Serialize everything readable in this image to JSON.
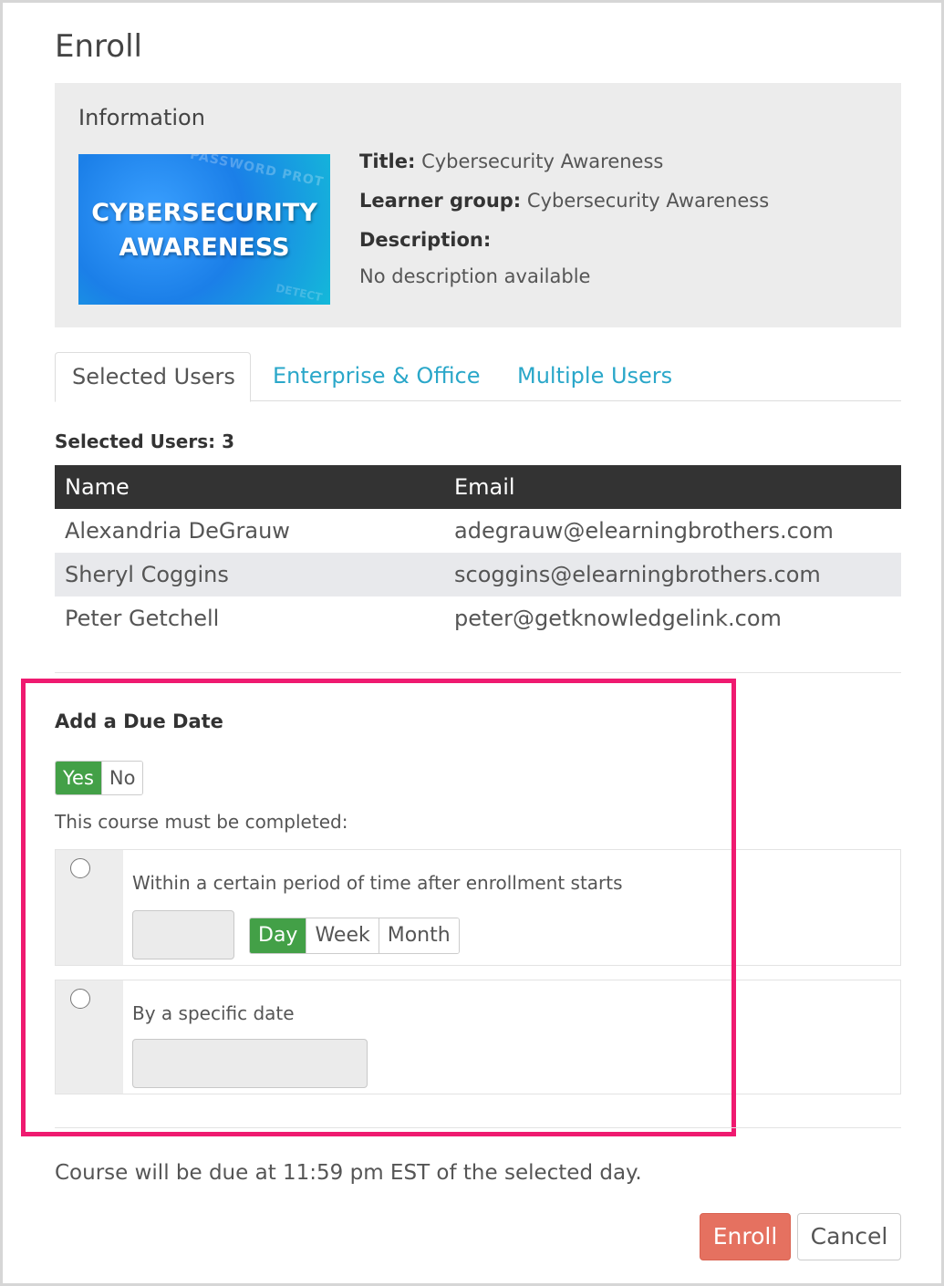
{
  "dialog": {
    "title": "Enroll"
  },
  "information": {
    "heading": "Information",
    "thumbnail": {
      "line1": "CYBERSECURITY",
      "line2": "AWARENESS",
      "deco_top": "PASSWORD PROT",
      "deco_bottom": "DETECT"
    },
    "title_label": "Title:",
    "title_value": "Cybersecurity Awareness",
    "group_label": "Learner group:",
    "group_value": "Cybersecurity Awareness",
    "description_label": "Description:",
    "description_value": "No description available"
  },
  "tabs": [
    {
      "label": "Selected Users",
      "active": true
    },
    {
      "label": "Enterprise & Office",
      "active": false
    },
    {
      "label": "Multiple Users",
      "active": false
    }
  ],
  "selected_count": "Selected Users: 3",
  "table": {
    "headers": [
      "Name",
      "Email"
    ],
    "rows": [
      {
        "name": "Alexandria DeGrauw",
        "email": "adegrauw@elearningbrothers.com"
      },
      {
        "name": "Sheryl Coggins",
        "email": "scoggins@elearningbrothers.com"
      },
      {
        "name": "Peter Getchell",
        "email": "peter@getknowledgelink.com"
      }
    ]
  },
  "due_date": {
    "heading": "Add a Due Date",
    "toggle": {
      "yes": "Yes",
      "no": "No",
      "selected": "Yes"
    },
    "instruction": "This course must be completed:",
    "option_period": {
      "label": "Within a certain period of time after enrollment starts",
      "amount_value": "",
      "units": [
        "Day",
        "Week",
        "Month"
      ],
      "selected_unit": "Day"
    },
    "option_date": {
      "label": "By a specific date",
      "date_value": ""
    }
  },
  "note": "Course will be due at 11:59 pm EST of the selected day.",
  "buttons": {
    "enroll": "Enroll",
    "cancel": "Cancel"
  },
  "colors": {
    "accent_green": "#43a047",
    "link_blue": "#2aa7c9",
    "enroll_button": "#e57160",
    "table_header": "#333333",
    "highlight_border": "#ef1a70"
  }
}
